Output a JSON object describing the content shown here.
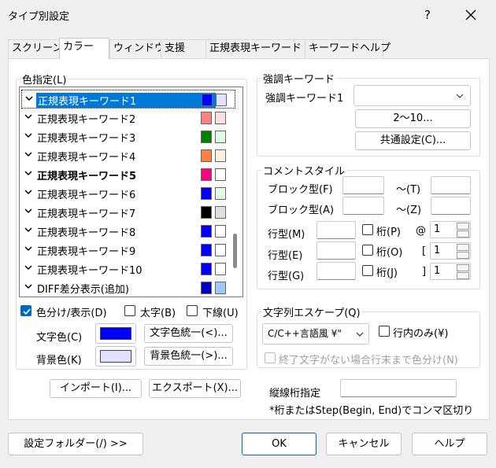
{
  "window": {
    "title": "タイプ別設定",
    "help_label": "?"
  },
  "tabs": [
    "スクリーン",
    "カラー",
    "ウィンドウ",
    "支援",
    "正規表現キーワード",
    "キーワードヘルプ"
  ],
  "color_group": {
    "label": "色指定(L)",
    "items": [
      {
        "label": "正規表現キーワード1",
        "fg": "#0000ff",
        "bg": "#e0e0ff",
        "checked": true,
        "bold": false
      },
      {
        "label": "正規表現キーワード2",
        "fg": "#ff8080",
        "bg": "#ffe0e0",
        "checked": true,
        "bold": false
      },
      {
        "label": "正規表現キーワード3",
        "fg": "#008000",
        "bg": "#e0ffe0",
        "checked": true,
        "bold": false
      },
      {
        "label": "正規表現キーワード4",
        "fg": "#ff8040",
        "bg": "#fff0e0",
        "checked": true,
        "bold": false
      },
      {
        "label": "正規表現キーワード5",
        "fg": "#ff0080",
        "bg": "#ffffff",
        "checked": true,
        "bold": true
      },
      {
        "label": "正規表現キーワード6",
        "fg": "#0000ff",
        "bg": "#e0ffe0",
        "checked": true,
        "bold": false
      },
      {
        "label": "正規表現キーワード7",
        "fg": "#000000",
        "bg": "#e0e0e0",
        "checked": true,
        "bold": false
      },
      {
        "label": "正規表現キーワード8",
        "fg": "#0000ff",
        "bg": "#ffffff",
        "checked": true,
        "bold": false
      },
      {
        "label": "正規表現キーワード9",
        "fg": "#0000ff",
        "bg": "#ffffff",
        "checked": true,
        "bold": false
      },
      {
        "label": "正規表現キーワード10",
        "fg": "#0000ff",
        "bg": "#ffffff",
        "checked": true,
        "bold": false
      },
      {
        "label": "DIFF差分表示(追加)",
        "fg": "#0000c0",
        "bg": "#a0c8ff",
        "checked": true,
        "bold": false
      }
    ],
    "chk_color": "色分け/表示(D)",
    "chk_bold": "太字(B)",
    "chk_underline": "下線(U)",
    "text_color_label": "文字色(C)",
    "text_color": "#0000ff",
    "bg_color_label": "背景色(K)",
    "bg_color": "#e0e0ff",
    "unify_text": "文字色統一(<)...",
    "unify_bg": "背景色統一(>)..."
  },
  "import_button": "インポート(I)...",
  "export_button": "エクスポート(X)...",
  "emphasis": {
    "label": "強調キーワード",
    "kw1_label": "強調キーワード1",
    "kw1_value": "",
    "btn_2_10": "2～10...",
    "btn_common": "共通設定(C)..."
  },
  "comment": {
    "label": "コメントスタイル",
    "block_f": "ブロック型(F)",
    "tilde_t": "～(T)",
    "block_a": "ブロック型(A)",
    "tilde_z": "～(Z)",
    "line_m": "行型(M)",
    "line_e": "行型(E)",
    "line_g": "行型(G)",
    "col_p": "桁(P)",
    "col_o": "桁(O)",
    "col_j": "桁(J)",
    "sym_at": "@",
    "sym_lb": "[",
    "sym_rb": "]",
    "spin_values": [
      "1",
      "1",
      "1"
    ]
  },
  "escape": {
    "label": "文字列エスケープ(Q)",
    "combo_value": "C/C++言語風 ¥\"",
    "line_only": "行内のみ(¥)",
    "no_end": "終了文字がない場合行末まで色分け(N)"
  },
  "vline": {
    "label": "縦線桁指定",
    "value": "",
    "hint": "*桁またはStep(Begin, End)でコンマ区切り"
  },
  "footer": {
    "settings_folder": "設定フォルダー(/) >>",
    "ok": "OK",
    "cancel": "キャンセル",
    "help": "ヘルプ"
  }
}
